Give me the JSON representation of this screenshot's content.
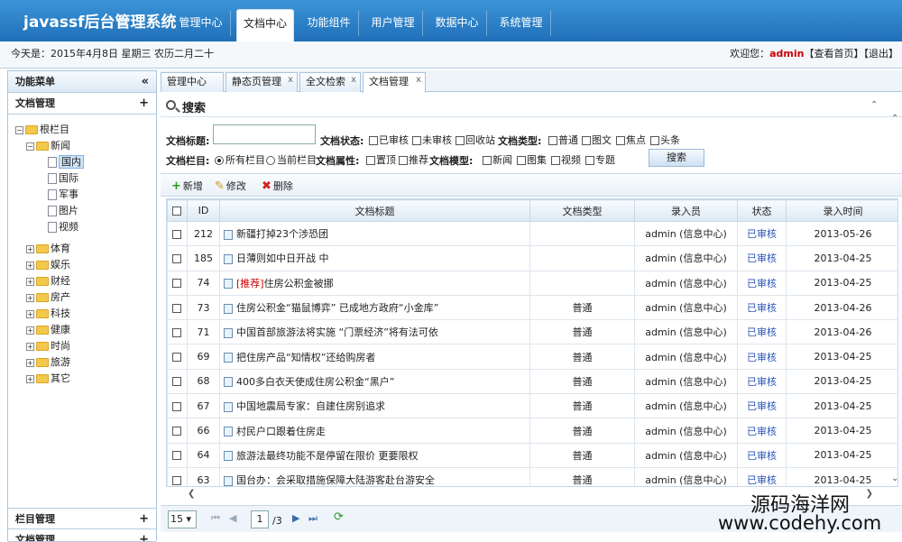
{
  "app": {
    "title": "javassf后台管理系统"
  },
  "nav": {
    "tabs": [
      {
        "label": "管理中心"
      },
      {
        "label": "文档中心"
      },
      {
        "label": "功能组件"
      },
      {
        "label": "用户管理"
      },
      {
        "label": "数据中心"
      },
      {
        "label": "系统管理"
      }
    ],
    "active": "文档中心"
  },
  "infobar": {
    "date": "今天是：2015年4月8日 星期三 农历二月二十",
    "welcome_prefix": "欢迎您：",
    "user": "admin",
    "links": "【查看首页】【退出】"
  },
  "sidebar": {
    "header": "功能菜单",
    "collapse": "«",
    "sections": [
      {
        "label": "文档管理",
        "toggle": "+"
      },
      {
        "label": "栏目管理",
        "toggle": "+"
      },
      {
        "label": "文档管理",
        "toggle": "+"
      }
    ],
    "tree": {
      "root": "根栏目",
      "news": "新闻",
      "news_children": [
        "国内",
        "国际",
        "军事",
        "图片",
        "视频"
      ],
      "others": [
        "体育",
        "娱乐",
        "财经",
        "房产",
        "科技",
        "健康",
        "时尚",
        "旅游",
        "其它"
      ]
    }
  },
  "workspace_tabs": [
    {
      "label": "管理中心"
    },
    {
      "label": "静态页管理",
      "close": "x"
    },
    {
      "label": "全文检索",
      "close": "x"
    },
    {
      "label": "文档管理",
      "close": "x"
    }
  ],
  "search": {
    "title": "搜索",
    "collapse": "⌃",
    "doc_title_label": "文档标题:",
    "doc_status_label": "文档状态:",
    "doc_status_options": [
      "已审核",
      "未审核",
      "回收站"
    ],
    "doc_type_label": "文档类型:",
    "doc_type_options": [
      "普通",
      "图文",
      "焦点",
      "头条"
    ],
    "column_label": "文档栏目:",
    "column_options": [
      "所有栏目",
      "当前栏目"
    ],
    "attr_label": "文档属性:",
    "attr_options": [
      "置顶",
      "推荐"
    ],
    "model_label": "文档模型:",
    "model_options": [
      "新闻",
      "图集",
      "视频",
      "专题"
    ],
    "button": "搜索"
  },
  "toolbar": {
    "add": "新增",
    "edit": "修改",
    "delete": "删除"
  },
  "grid": {
    "columns": [
      "ID",
      "文档标题",
      "文档类型",
      "录入员",
      "状态",
      "录入时间"
    ],
    "rows": [
      {
        "id": "212",
        "tag": "",
        "title": "新疆打掉23个涉恐团",
        "type": "",
        "author": "admin (信息中心)",
        "status": "已审核",
        "time": "2013-05-26"
      },
      {
        "id": "185",
        "tag": "",
        "title": "日薄则如中日开战 中",
        "type": "",
        "author": "admin (信息中心)",
        "status": "已审核",
        "time": "2013-04-25"
      },
      {
        "id": "74",
        "tag": "[推荐]",
        "title": "住房公积金被挪",
        "type": "",
        "author": "admin (信息中心)",
        "status": "已审核",
        "time": "2013-04-25"
      },
      {
        "id": "73",
        "tag": "",
        "title": "住房公积金“猫鼠博弈” 已成地方政府“小金库”",
        "type": "普通",
        "author": "admin (信息中心)",
        "status": "已审核",
        "time": "2013-04-26"
      },
      {
        "id": "71",
        "tag": "",
        "title": "中国首部旅游法将实施 “门票经济”将有法可依",
        "type": "普通",
        "author": "admin (信息中心)",
        "status": "已审核",
        "time": "2013-04-26"
      },
      {
        "id": "69",
        "tag": "",
        "title": "把住房产品“知情权”还给购房者",
        "type": "普通",
        "author": "admin (信息中心)",
        "status": "已审核",
        "time": "2013-04-25"
      },
      {
        "id": "68",
        "tag": "",
        "title": "400多白衣天使成住房公积金“黑户”",
        "type": "普通",
        "author": "admin (信息中心)",
        "status": "已审核",
        "time": "2013-04-25"
      },
      {
        "id": "67",
        "tag": "",
        "title": "中国地震局专家：自建住房别追求",
        "type": "普通",
        "author": "admin (信息中心)",
        "status": "已审核",
        "time": "2013-04-25"
      },
      {
        "id": "66",
        "tag": "",
        "title": "村民户口跟着住房走",
        "type": "普通",
        "author": "admin (信息中心)",
        "status": "已审核",
        "time": "2013-04-25"
      },
      {
        "id": "64",
        "tag": "",
        "title": "旅游法最终功能不是停留在限价 更要限权",
        "type": "普通",
        "author": "admin (信息中心)",
        "status": "已审核",
        "time": "2013-04-25"
      },
      {
        "id": "63",
        "tag": "",
        "title": "国台办：会采取措施保障大陆游客赴台游安全",
        "type": "普通",
        "author": "admin (信息中心)",
        "status": "已审核",
        "time": "2013-04-25"
      }
    ]
  },
  "pager": {
    "page_size": "15",
    "current": "1",
    "total": "/3"
  },
  "watermark": {
    "line1": "源码海洋网",
    "line2": "www.codehy.com"
  },
  "colors": {
    "header": "#2a7fc8",
    "status": "#2a55b8",
    "accent": "#cc0000"
  }
}
